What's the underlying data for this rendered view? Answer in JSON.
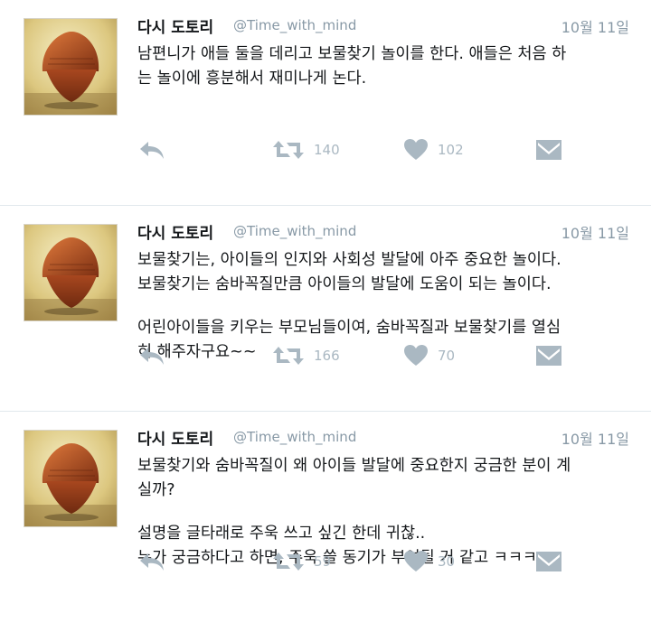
{
  "tweets": [
    {
      "name": "다시 도토리",
      "handle": "@Time_with_mind",
      "date": "10월 11일",
      "lines": [
        "남편니가 애들 둘을 데리고 보물찾기 놀이를 한다. 애들은 처음 하",
        "는 놀이에 흥분해서 재미나게 논다."
      ],
      "retweets": "140",
      "likes": "102"
    },
    {
      "name": "다시 도토리",
      "handle": "@Time_with_mind",
      "date": "10월 11일",
      "lines": [
        "보물찾기는, 아이들의 인지와 사회성 발달에 아주 중요한 놀이다.",
        "보물찾기는 숨바꼭질만큼 아이들의 발달에 도움이 되는 놀이다.",
        "",
        "어린아이들을 키우는 부모님들이여, 숨바꼭질과 보물찾기를 열심",
        "히 해주자구요~~"
      ],
      "retweets": "166",
      "likes": "70"
    },
    {
      "name": "다시 도토리",
      "handle": "@Time_with_mind",
      "date": "10월 11일",
      "lines": [
        "보물찾기와 숨바꼭질이 왜 아이들 발달에 중요한지 궁금한 분이 계",
        "실까?",
        "",
        "설명을 글타래로 주욱 쓰고 싶긴 한데 귀찮..",
        "누가 궁금하다고 하면, 주욱 쓸 동기가 부여될 거 같고 ㅋㅋㅋ"
      ],
      "retweets": "59",
      "likes": "30"
    }
  ],
  "icons": {
    "avatar": "acorn-avatar",
    "reply": "reply-icon",
    "retweet": "retweet-icon",
    "like": "heart-icon",
    "message": "envelope-icon"
  },
  "colors": {
    "icon": "#aab8c2",
    "meta": "#8899a6",
    "divider": "#e1e8ed"
  }
}
